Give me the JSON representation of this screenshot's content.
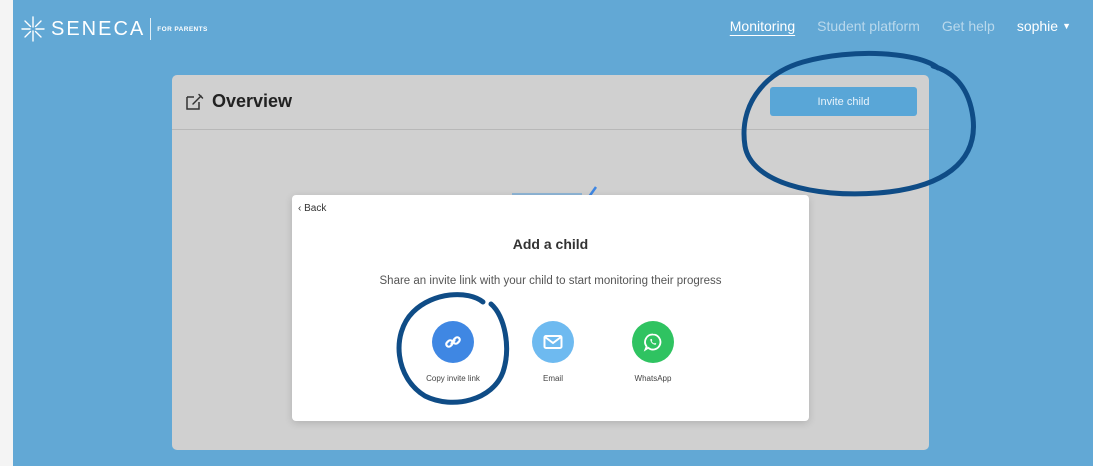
{
  "brand": {
    "name": "SENECA",
    "sub": "FOR PARENTS"
  },
  "nav": {
    "items": [
      "Monitoring",
      "Student platform",
      "Get help"
    ],
    "user": "sophie"
  },
  "panel": {
    "title": "Overview",
    "invite_label": "Invite child"
  },
  "modal": {
    "back_label": "‹ Back",
    "title": "Add a child",
    "subtitle": "Share an invite link with your child to start monitoring their progress",
    "options": [
      {
        "label": "Copy invite link",
        "icon": "link-icon",
        "color": "#3f87e3"
      },
      {
        "label": "Email",
        "icon": "envelope-icon",
        "color": "#6ebaf0"
      },
      {
        "label": "WhatsApp",
        "icon": "whatsapp-icon",
        "color": "#2fc361"
      }
    ]
  },
  "colors": {
    "background": "#62a8d5",
    "annotation": "#0f4c86"
  }
}
